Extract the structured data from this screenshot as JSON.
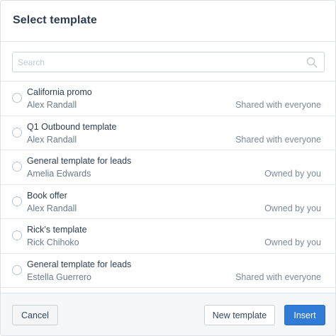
{
  "dialog": {
    "title": "Select template"
  },
  "search": {
    "placeholder": "Search",
    "value": ""
  },
  "templates": [
    {
      "name": "California promo",
      "owner": "Alex Randall",
      "sharing": "Shared with everyone"
    },
    {
      "name": "Q1 Outbound template",
      "owner": "Alex Randall",
      "sharing": "Shared with everyone"
    },
    {
      "name": "General template for leads",
      "owner": "Amelia Edwards",
      "sharing": "Owned by you"
    },
    {
      "name": "Book offer",
      "owner": "Alex Randall",
      "sharing": "Owned by you"
    },
    {
      "name": "Rick’s template",
      "owner": "Rick Chihoko",
      "sharing": "Owned by you"
    },
    {
      "name": "General template for leads",
      "owner": "Estella Guerrero",
      "sharing": "Shared with everyone"
    }
  ],
  "footer": {
    "cancel_label": "Cancel",
    "new_template_label": "New template",
    "insert_label": "Insert"
  },
  "colors": {
    "primary": "#2f7bd6",
    "title_text": "#2d3e50",
    "muted_text": "#7c8a98"
  },
  "icons": {
    "search": "search-icon",
    "radio": "radio-unchecked-icon"
  }
}
